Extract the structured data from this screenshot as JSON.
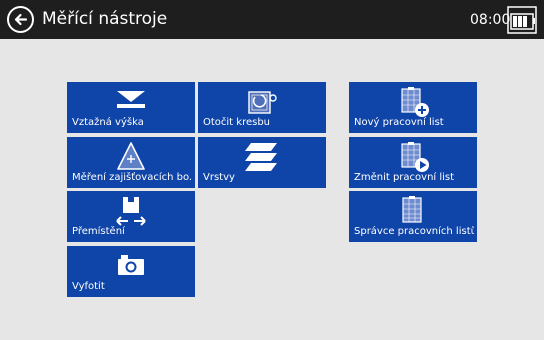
{
  "header": {
    "title": "Měřící nástroje",
    "time": "08:00",
    "back_icon": "back-arrow-icon",
    "battery_icon": "battery-icon"
  },
  "tiles": {
    "reference_height": {
      "label": "Vztažná výška",
      "icon": "reference-height-icon"
    },
    "rotate_drawing": {
      "label": "Otočit kresbu",
      "icon": "rotate-drawing-icon"
    },
    "measure_points": {
      "label": "Měření zajišťovacích bo...",
      "icon": "triangle-point-icon"
    },
    "layers": {
      "label": "Vrstvy",
      "icon": "layers-icon"
    },
    "move": {
      "label": "Přemístění",
      "icon": "move-icon"
    },
    "photo": {
      "label": "Vyfotit",
      "icon": "camera-icon"
    },
    "new_worksheet": {
      "label": "Nový pracovní list",
      "icon": "new-worksheet-icon"
    },
    "change_worksheet": {
      "label": "Změnit pracovní list",
      "icon": "change-worksheet-icon"
    },
    "worksheet_manager": {
      "label": "Správce pracovních listů",
      "icon": "worksheet-manager-icon"
    }
  },
  "colors": {
    "tile": "#0f44a8",
    "titlebar": "#1e1e1e",
    "background": "#e6e6e6"
  }
}
